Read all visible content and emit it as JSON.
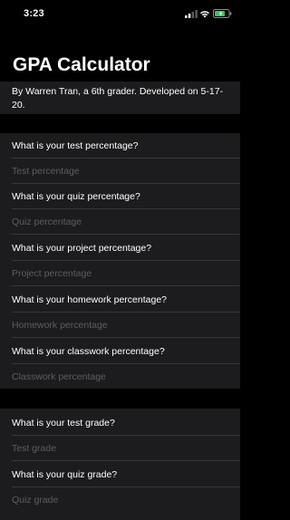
{
  "status_bar": {
    "time": "3:23"
  },
  "header": {
    "title": "GPA Calculator",
    "subtitle": "By Warren Tran, a 6th grader. Developed on 5-17-20."
  },
  "sections": [
    {
      "items": [
        {
          "question": "What is your test percentage?",
          "placeholder": "Test percentage"
        },
        {
          "question": "What is your quiz percentage?",
          "placeholder": "Quiz percentage"
        },
        {
          "question": "What is your project percentage?",
          "placeholder": "Project percentage"
        },
        {
          "question": "What is your homework percentage?",
          "placeholder": "Homework percentage"
        },
        {
          "question": "What is your classwork percentage?",
          "placeholder": "Classwork percentage"
        }
      ]
    },
    {
      "items": [
        {
          "question": "What is your test grade?",
          "placeholder": "Test grade"
        },
        {
          "question": "What is your quiz grade?",
          "placeholder": "Quiz grade"
        }
      ]
    }
  ]
}
